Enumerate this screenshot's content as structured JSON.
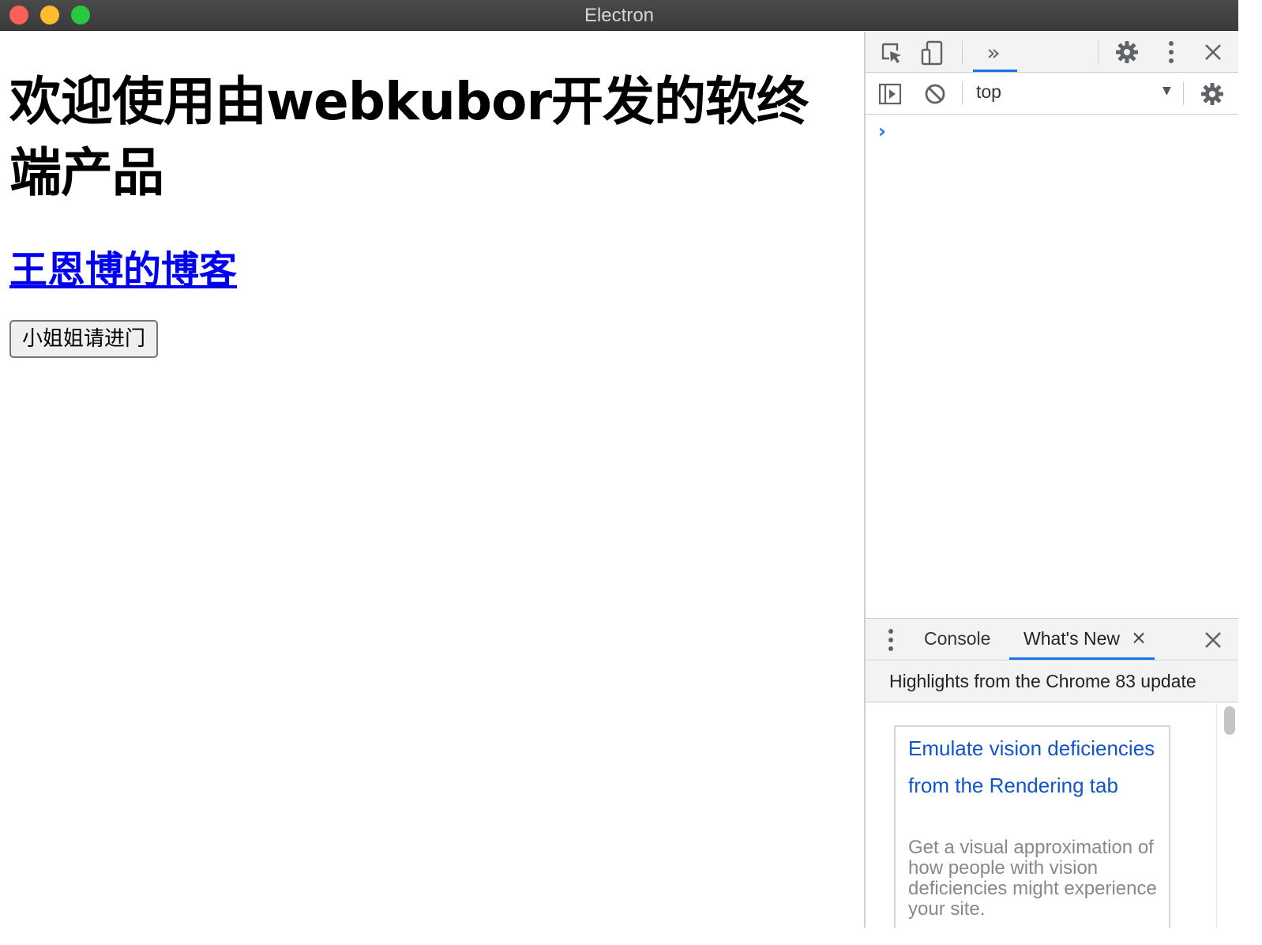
{
  "window": {
    "title": "Electron"
  },
  "page": {
    "heading": "欢迎使用由webkubor开发的软终端产品",
    "blog_link": "王恩博的博客",
    "enter_button": "小姐姐请进门"
  },
  "devtools": {
    "toolbar": {
      "inspect_icon": "inspect-element-icon",
      "device_icon": "device-toolbar-icon",
      "more_tabs_label": "»",
      "settings_icon": "gear-icon",
      "menu_icon": "vertical-dots-icon",
      "close_icon": "close-icon"
    },
    "console_toolbar": {
      "sidebar_icon": "sidebar-toggle-icon",
      "clear_icon": "clear-console-icon",
      "context": "top",
      "settings_icon": "gear-icon"
    },
    "console": {
      "prompt": "›"
    },
    "drawer": {
      "tabs": [
        {
          "label": "Console"
        },
        {
          "label": "What's New"
        }
      ],
      "tab_close": "×",
      "close": "×"
    },
    "whats_new": {
      "header": "Highlights from the Chrome 83 update",
      "card_title": "Emulate vision deficiencies from the Rendering tab",
      "card_desc": "Get a visual approximation of how people with vision deficiencies might experience your site."
    },
    "accent_color": "#1a73e8",
    "link_color": "#1155cc"
  }
}
